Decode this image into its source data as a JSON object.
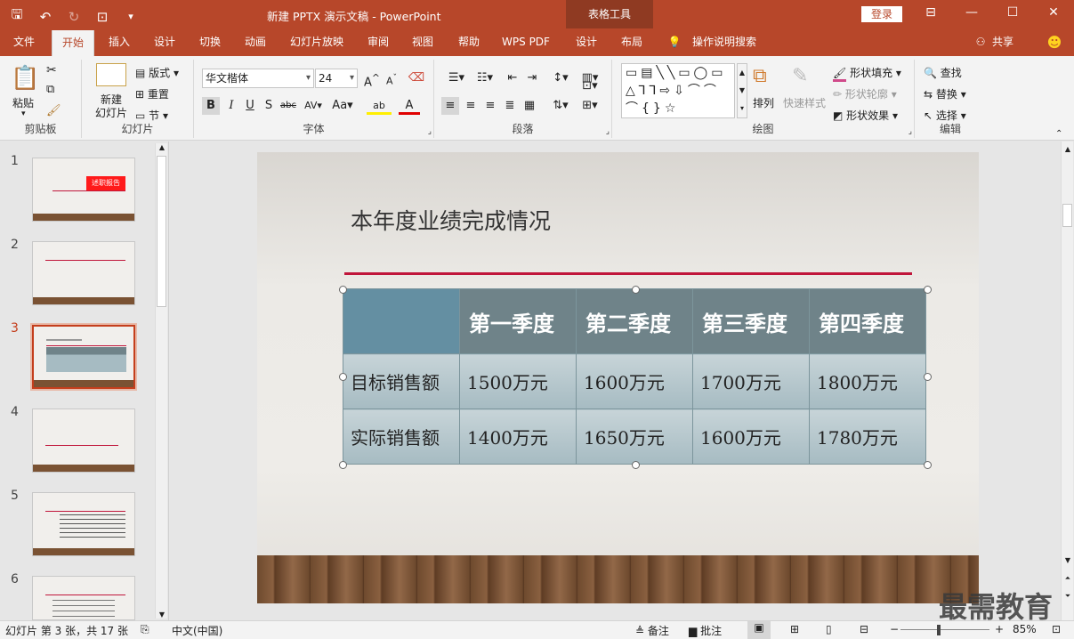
{
  "window": {
    "title": "新建 PPTX 演示文稿  -  PowerPoint",
    "context_title": "表格工具",
    "login": "登录"
  },
  "tabs": [
    "文件",
    "开始",
    "插入",
    "设计",
    "切换",
    "动画",
    "幻灯片放映",
    "审阅",
    "视图",
    "帮助",
    "WPS PDF",
    "设计",
    "布局"
  ],
  "tell_me": "操作说明搜索",
  "share": "共享",
  "ribbon": {
    "clipboard": {
      "label": "剪贴板",
      "paste": "粘贴"
    },
    "slides": {
      "label": "幻灯片",
      "new_slide": "新建\n幻灯片",
      "layout": "版式",
      "reset": "重置",
      "section": "节"
    },
    "font": {
      "label": "字体",
      "font_name": "华文楷体",
      "font_size": "24"
    },
    "paragraph": {
      "label": "段落"
    },
    "drawing": {
      "label": "绘图",
      "arrange": "排列",
      "quick_styles": "快速样式",
      "shape_fill": "形状填充",
      "shape_outline": "形状轮廓",
      "shape_effects": "形状效果"
    },
    "editing": {
      "label": "编辑",
      "find": "查找",
      "replace": "替换",
      "select": "选择"
    }
  },
  "thumbnails": [
    {
      "num": "1",
      "badge": "述职报告"
    },
    {
      "num": "2"
    },
    {
      "num": "3"
    },
    {
      "num": "4"
    },
    {
      "num": "5"
    },
    {
      "num": "6"
    }
  ],
  "slide": {
    "title": "本年度业绩完成情况",
    "table": {
      "headers": [
        "",
        "第一季度",
        "第二季度",
        "第三季度",
        "第四季度"
      ],
      "rows": [
        [
          "目标销售额",
          "1500万元",
          "1600万元",
          "1700万元",
          "1800万元"
        ],
        [
          "实际销售额",
          "1400万元",
          "1650万元",
          "1600万元",
          "1780万元"
        ]
      ]
    }
  },
  "status": {
    "slide_info": "幻灯片 第 3 张，共 17 张",
    "language": "中文(中国)",
    "notes": "备注",
    "comments": "批注",
    "zoom": "85%"
  },
  "watermark": "最需教育",
  "colors": {
    "accent": "#b7472a",
    "title_red_line": "#c0163b",
    "table_header": "#6f8389"
  }
}
